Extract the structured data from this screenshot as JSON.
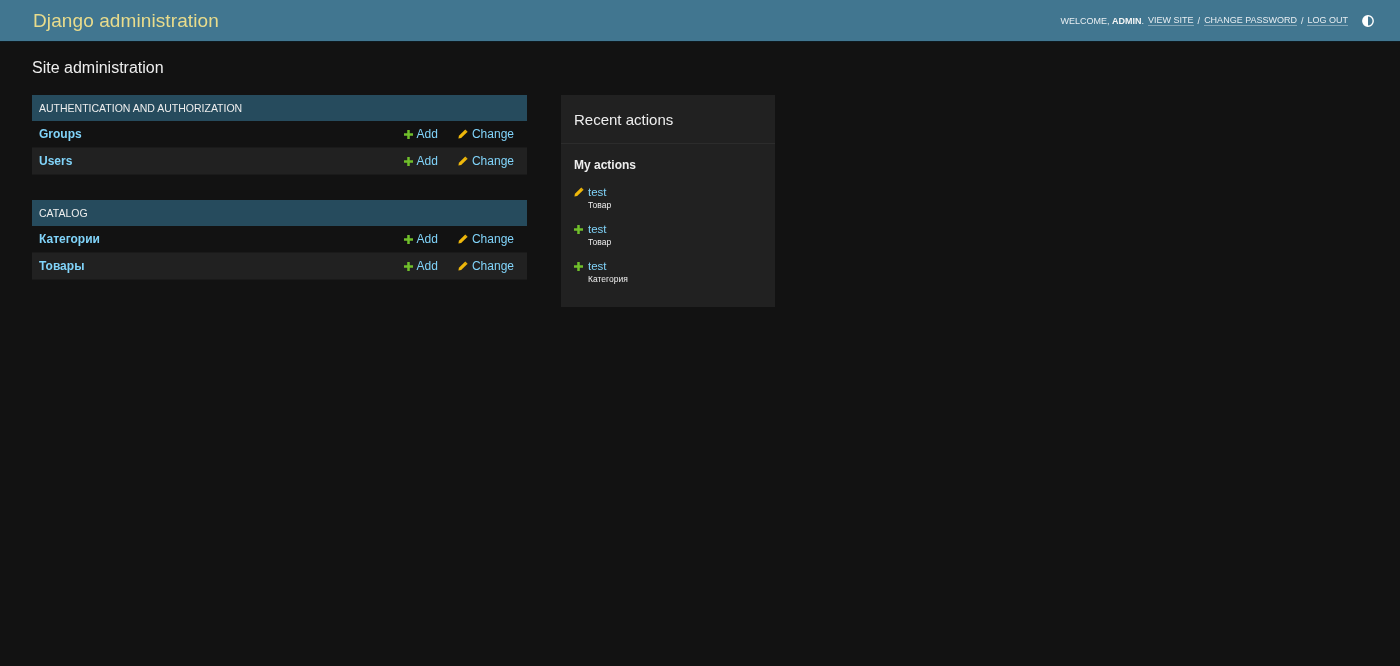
{
  "header": {
    "title": "Django administration",
    "user_tools": [
      {
        "kind": "text",
        "text": "WELCOME, **ADMIN**."
      },
      {
        "kind": "link",
        "text": "VIEW SITE"
      },
      {
        "kind": "text",
        "text": "/"
      },
      {
        "kind": "link",
        "text": "CHANGE PASSWORD"
      },
      {
        "kind": "text",
        "text": "/"
      },
      {
        "kind": "link",
        "text": "LOG OUT"
      }
    ]
  },
  "page_title": "Site administration",
  "modules": [
    {
      "caption": "AUTHENTICATION AND AUTHORIZATION",
      "models": [
        {
          "name": "Groups",
          "add": "Add",
          "change": "Change"
        },
        {
          "name": "Users",
          "add": "Add",
          "change": "Change"
        }
      ]
    },
    {
      "caption": "CATALOG",
      "models": [
        {
          "name": "Категории",
          "add": "Add",
          "change": "Change"
        },
        {
          "name": "Товары",
          "add": "Add",
          "change": "Change"
        }
      ]
    }
  ],
  "recent_actions": {
    "title": "Recent actions",
    "subtitle": "My actions",
    "entries": [
      {
        "kind": "change",
        "label": "test",
        "content_type": "Товар"
      },
      {
        "kind": "addition",
        "label": "test",
        "content_type": "Товар"
      },
      {
        "kind": "addition",
        "label": "test",
        "content_type": "Категория"
      }
    ]
  }
}
